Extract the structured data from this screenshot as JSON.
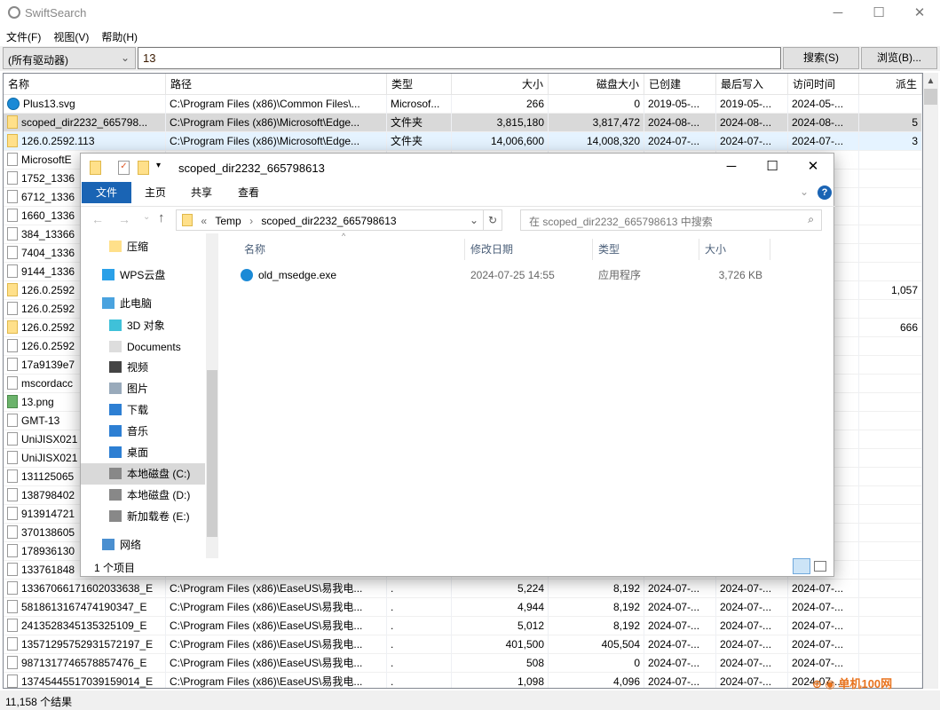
{
  "app": {
    "title": "SwiftSearch",
    "menu": [
      "文件(F)",
      "视图(V)",
      "帮助(H)"
    ],
    "drive": "(所有驱动器)",
    "query": "13",
    "search_btn": "搜索(S)",
    "browse_btn": "浏览(B)...",
    "status": "11,158 个结果"
  },
  "columns": [
    "名称",
    "路径",
    "类型",
    "大小",
    "磁盘大小",
    "已创建",
    "最后写入",
    "访问时间",
    "派生"
  ],
  "rows": [
    {
      "icon": "edge",
      "name": "Plus13.svg",
      "path": "C:\\Program Files (x86)\\Common Files\\...",
      "type": "Microsof...",
      "size": "266",
      "disk": "0",
      "created": "2019-05-...",
      "written": "2019-05-...",
      "accessed": "2024-05-...",
      "derived": "",
      "state": "normal"
    },
    {
      "icon": "folder",
      "name": "scoped_dir2232_665798...",
      "path": "C:\\Program Files (x86)\\Microsoft\\Edge...",
      "type": "文件夹",
      "size": "3,815,180",
      "disk": "3,817,472",
      "created": "2024-08-...",
      "written": "2024-08-...",
      "accessed": "2024-08-...",
      "derived": "5",
      "state": "selected"
    },
    {
      "icon": "folder",
      "name": "126.0.2592.113",
      "path": "C:\\Program Files (x86)\\Microsoft\\Edge...",
      "type": "文件夹",
      "size": "14,006,600",
      "disk": "14,008,320",
      "created": "2024-07-...",
      "written": "2024-07-...",
      "accessed": "2024-07-...",
      "derived": "3",
      "state": "hover"
    },
    {
      "icon": "file",
      "name": "MicrosoftE"
    },
    {
      "icon": "file",
      "name": "1752_1336"
    },
    {
      "icon": "file",
      "name": "6712_1336"
    },
    {
      "icon": "file",
      "name": "1660_1336"
    },
    {
      "icon": "file",
      "name": "384_13366"
    },
    {
      "icon": "file",
      "name": "7404_1336"
    },
    {
      "icon": "file",
      "name": "9144_1336"
    },
    {
      "icon": "folder",
      "name": "126.0.2592",
      "derived": "1,057"
    },
    {
      "icon": "file",
      "name": "126.0.2592"
    },
    {
      "icon": "folder",
      "name": "126.0.2592",
      "derived": "666"
    },
    {
      "icon": "file",
      "name": "126.0.2592"
    },
    {
      "icon": "file",
      "name": "17a9139e7"
    },
    {
      "icon": "file",
      "name": "mscordacc"
    },
    {
      "icon": "png",
      "name": "13.png"
    },
    {
      "icon": "file",
      "name": "GMT-13"
    },
    {
      "icon": "file",
      "name": "UniJISX021"
    },
    {
      "icon": "file",
      "name": "UniJISX021"
    },
    {
      "icon": "file",
      "name": "131125065"
    },
    {
      "icon": "file",
      "name": "138798402"
    },
    {
      "icon": "file",
      "name": "913914721"
    },
    {
      "icon": "file",
      "name": "370138605"
    },
    {
      "icon": "file",
      "name": "178936130"
    },
    {
      "icon": "file",
      "name": "133761848"
    },
    {
      "icon": "file",
      "name": "13367066171602033638_E",
      "path": "C:\\Program Files (x86)\\EaseUS\\易我电...",
      "type": ".",
      "size": "5,224",
      "disk": "8,192",
      "created": "2024-07-...",
      "written": "2024-07-...",
      "accessed": "2024-07-..."
    },
    {
      "icon": "file",
      "name": "5818613167474190347_E",
      "path": "C:\\Program Files (x86)\\EaseUS\\易我电...",
      "type": ".",
      "size": "4,944",
      "disk": "8,192",
      "created": "2024-07-...",
      "written": "2024-07-...",
      "accessed": "2024-07-..."
    },
    {
      "icon": "file",
      "name": "2413528345135325109_E",
      "path": "C:\\Program Files (x86)\\EaseUS\\易我电...",
      "type": ".",
      "size": "5,012",
      "disk": "8,192",
      "created": "2024-07-...",
      "written": "2024-07-...",
      "accessed": "2024-07-..."
    },
    {
      "icon": "file",
      "name": "13571295752931572197_E",
      "path": "C:\\Program Files (x86)\\EaseUS\\易我电...",
      "type": ".",
      "size": "401,500",
      "disk": "405,504",
      "created": "2024-07-...",
      "written": "2024-07-...",
      "accessed": "2024-07-..."
    },
    {
      "icon": "file",
      "name": "9871317746578857476_E",
      "path": "C:\\Program Files (x86)\\EaseUS\\易我电...",
      "type": ".",
      "size": "508",
      "disk": "0",
      "created": "2024-07-...",
      "written": "2024-07-...",
      "accessed": "2024-07-..."
    },
    {
      "icon": "file",
      "name": "13745445517039159014_E",
      "path": "C:\\Program Files (x86)\\EaseUS\\易我电...",
      "type": ".",
      "size": "1,098",
      "disk": "4,096",
      "created": "2024-07-...",
      "written": "2024-07-...",
      "accessed": "2024-07-..."
    }
  ],
  "explorer": {
    "title": "scoped_dir2232_665798613",
    "tabs": [
      "文件",
      "主页",
      "共享",
      "查看"
    ],
    "breadcrumb": [
      "«",
      "Temp",
      "scoped_dir2232_665798613"
    ],
    "search_placeholder": "在 scoped_dir2232_665798613 中搜索",
    "nav": [
      {
        "label": "压缩",
        "icon": "folder",
        "indent": 1
      },
      {
        "label": "WPS云盘",
        "icon": "cloud",
        "indent": 0
      },
      {
        "label": "此电脑",
        "icon": "pc",
        "indent": 0
      },
      {
        "label": "3D 对象",
        "icon": "cube",
        "indent": 1
      },
      {
        "label": "Documents",
        "icon": "doc",
        "indent": 1
      },
      {
        "label": "视频",
        "icon": "video",
        "indent": 1
      },
      {
        "label": "图片",
        "icon": "picture",
        "indent": 1
      },
      {
        "label": "下载",
        "icon": "download",
        "indent": 1
      },
      {
        "label": "音乐",
        "icon": "music",
        "indent": 1
      },
      {
        "label": "桌面",
        "icon": "desktop",
        "indent": 1
      },
      {
        "label": "本地磁盘 (C:)",
        "icon": "drive",
        "indent": 1,
        "selected": true
      },
      {
        "label": "本地磁盘 (D:)",
        "icon": "drive",
        "indent": 1
      },
      {
        "label": "新加载卷 (E:)",
        "icon": "drive",
        "indent": 1
      },
      {
        "label": "网络",
        "icon": "network",
        "indent": 0
      }
    ],
    "columns": [
      "名称",
      "修改日期",
      "类型",
      "大小"
    ],
    "files": [
      {
        "name": "old_msedge.exe",
        "modified": "2024-07-25 14:55",
        "type": "应用程序",
        "size": "3,726 KB"
      }
    ],
    "status": "1 个项目"
  },
  "watermark": "单机100网 danji100.com"
}
